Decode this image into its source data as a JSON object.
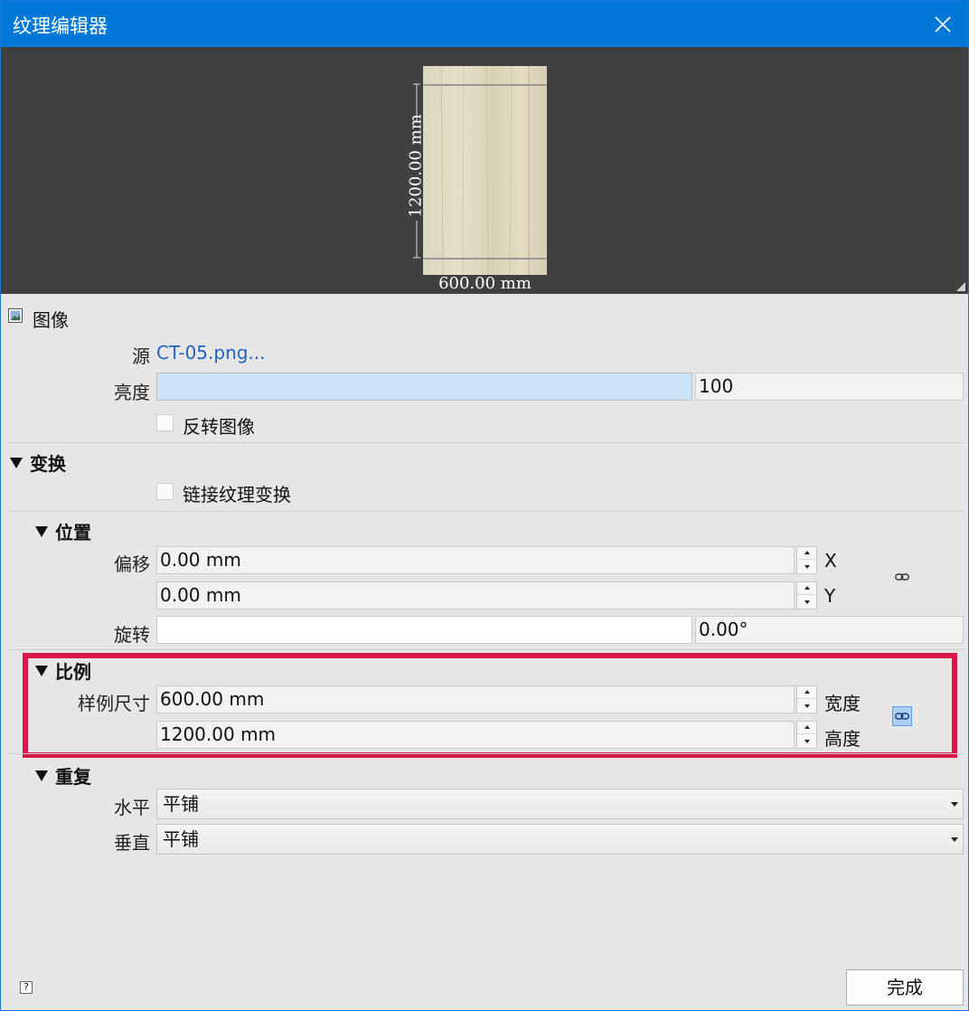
{
  "window": {
    "title": "纹理编辑器"
  },
  "preview": {
    "width_label": "600.00 mm",
    "height_label": "1200.00 mm"
  },
  "image_section": {
    "title": "图像",
    "source_label": "源",
    "source_value": "CT-05.png...",
    "brightness_label": "亮度",
    "brightness_value": "100",
    "invert_label": "反转图像"
  },
  "transform_section": {
    "title": "变换",
    "link_label": "链接纹理变换"
  },
  "position_section": {
    "title": "位置",
    "offset_label": "偏移",
    "offset_x": "0.00 mm",
    "offset_y": "0.00 mm",
    "x_label": "X",
    "y_label": "Y",
    "rotate_label": "旋转",
    "rotate_value": "0.00°"
  },
  "scale_section": {
    "title": "比例",
    "size_label": "样例尺寸",
    "width_value": "600.00 mm",
    "height_value": "1200.00 mm",
    "width_label": "宽度",
    "height_label": "高度"
  },
  "repeat_section": {
    "title": "重复",
    "horizontal_label": "水平",
    "horizontal_value": "平铺",
    "vertical_label": "垂直",
    "vertical_value": "平铺"
  },
  "footer": {
    "done_label": "完成",
    "help_label": "?"
  },
  "colors": {
    "titlebar": "#0078d7",
    "highlight": "#d9184a",
    "link": "#1f64c4"
  }
}
